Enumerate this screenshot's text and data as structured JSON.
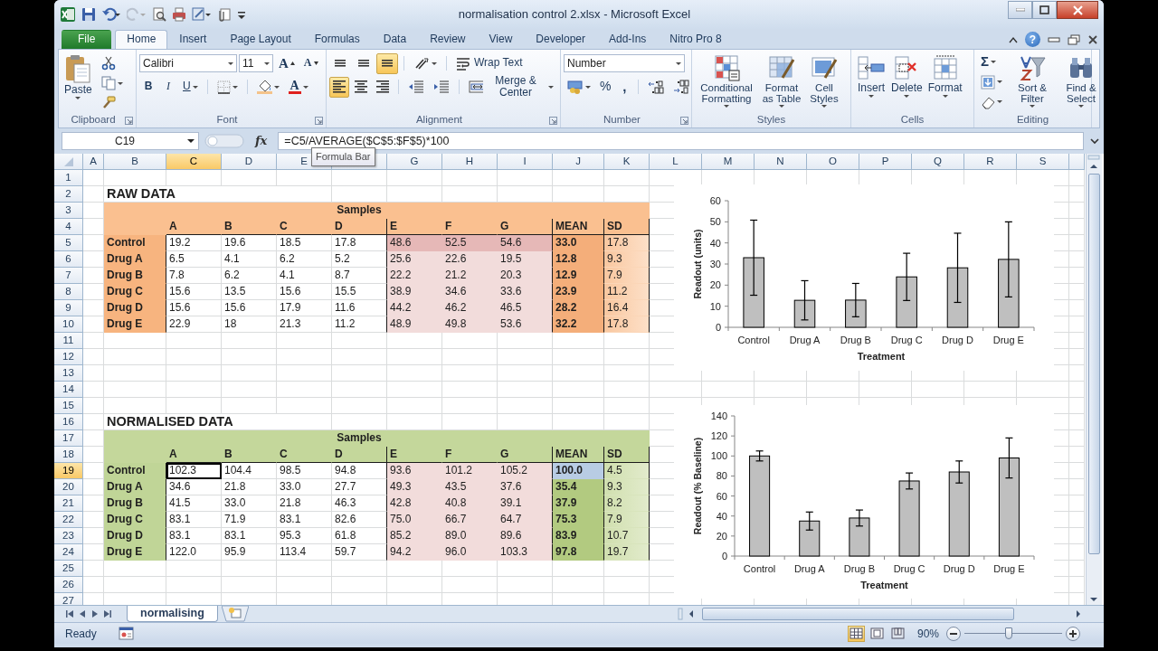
{
  "title_bar": {
    "title": "normalisation control 2.xlsx  -  Microsoft Excel"
  },
  "ribbon_tabs": [
    {
      "label": "File",
      "kind": "file",
      "selected": false
    },
    {
      "label": "Home",
      "kind": "tab",
      "selected": true
    },
    {
      "label": "Insert",
      "kind": "tab",
      "selected": false
    },
    {
      "label": "Page Layout",
      "kind": "tab",
      "selected": false
    },
    {
      "label": "Formulas",
      "kind": "tab",
      "selected": false
    },
    {
      "label": "Data",
      "kind": "tab",
      "selected": false
    },
    {
      "label": "Review",
      "kind": "tab",
      "selected": false
    },
    {
      "label": "View",
      "kind": "tab",
      "selected": false
    },
    {
      "label": "Developer",
      "kind": "tab",
      "selected": false
    },
    {
      "label": "Add-Ins",
      "kind": "tab",
      "selected": false
    },
    {
      "label": "Nitro Pro 8",
      "kind": "tab",
      "selected": false
    }
  ],
  "help": "?",
  "ribbon": {
    "clipboard": {
      "label": "Clipboard",
      "paste": "Paste"
    },
    "font": {
      "label": "Font",
      "font_name": "Calibri",
      "font_size": "11",
      "grow": "A",
      "shrink": "A",
      "bold": "B",
      "italic": "I",
      "underline": "U",
      "font_color": "A"
    },
    "alignment": {
      "label": "Alignment",
      "wrap_text": "Wrap Text",
      "merge": "Merge & Center",
      "vertical": [
        {
          "selected": false
        },
        {
          "selected": false
        },
        {
          "selected": true
        }
      ],
      "horizontal": [
        {
          "selected": true
        },
        {
          "selected": false
        },
        {
          "selected": false
        }
      ]
    },
    "number": {
      "label": "Number",
      "format": "Number",
      "percent": "%",
      "comma": ","
    },
    "styles": {
      "label": "Styles",
      "conditional": "Conditional Formatting",
      "table": "Format as Table",
      "cell_styles": "Cell Styles"
    },
    "cells": {
      "label": "Cells",
      "insert": "Insert",
      "delete": "Delete",
      "format": "Format"
    },
    "editing": {
      "label": "Editing",
      "sum": "Σ",
      "sort": "Sort & Filter",
      "find": "Find & Select"
    }
  },
  "formula_bar": {
    "name_box": "C19",
    "fx": "fx",
    "formula": "=C5/AVERAGE($C$5:$F$5)*100",
    "tooltip": "Formula Bar"
  },
  "columns": [
    {
      "label": "A",
      "selected": false
    },
    {
      "label": "B",
      "selected": false
    },
    {
      "label": "C",
      "selected": true
    },
    {
      "label": "D",
      "selected": false
    },
    {
      "label": "E",
      "selected": false
    },
    {
      "selected": false
    },
    {
      "label": "G",
      "selected": false
    },
    {
      "label": "H",
      "selected": false
    },
    {
      "label": "I",
      "selected": false
    },
    {
      "label": "J",
      "selected": false
    },
    {
      "label": "K",
      "selected": false
    },
    {
      "label": "L",
      "selected": false
    },
    {
      "label": "M",
      "selected": false
    },
    {
      "label": "N",
      "selected": false
    },
    {
      "label": "O",
      "selected": false
    },
    {
      "label": "P",
      "selected": false
    },
    {
      "label": "Q",
      "selected": false
    },
    {
      "label": "R",
      "selected": false
    },
    {
      "label": "S",
      "selected": false
    }
  ],
  "rows": [
    {
      "label": "1",
      "selected": false
    },
    {
      "label": "2",
      "selected": false
    },
    {
      "label": "3",
      "selected": false
    },
    {
      "label": "4",
      "selected": false
    },
    {
      "label": "5",
      "selected": false
    },
    {
      "label": "6",
      "selected": false
    },
    {
      "label": "7",
      "selected": false
    },
    {
      "label": "8",
      "selected": false
    },
    {
      "label": "9",
      "selected": false
    },
    {
      "label": "10",
      "selected": false
    },
    {
      "label": "11",
      "selected": false
    },
    {
      "label": "12",
      "selected": false
    },
    {
      "label": "13",
      "selected": false
    },
    {
      "label": "14",
      "selected": false
    },
    {
      "label": "15",
      "selected": false
    },
    {
      "label": "16",
      "selected": false
    },
    {
      "label": "17",
      "selected": false
    },
    {
      "label": "18",
      "selected": false
    },
    {
      "label": "19",
      "selected": true
    },
    {
      "label": "20",
      "selected": false
    },
    {
      "label": "21",
      "selected": false
    },
    {
      "label": "22",
      "selected": false
    },
    {
      "label": "23",
      "selected": false
    },
    {
      "label": "24",
      "selected": false
    },
    {
      "label": "25",
      "selected": false
    },
    {
      "label": "26",
      "selected": false
    },
    {
      "label": "27",
      "selected": false
    }
  ],
  "raw_data": {
    "title": "RAW DATA",
    "samples": "Samples",
    "headers": [
      "A",
      "B",
      "C",
      "D",
      "E",
      "F",
      "G",
      "MEAN",
      "SD"
    ],
    "rows": [
      {
        "label": "Control",
        "highlighted": true,
        "values": [
          "19.2",
          "19.6",
          "18.5",
          "17.8",
          "48.6",
          "52.5",
          "54.6"
        ],
        "mean": "33.0",
        "sd": "17.8"
      },
      {
        "label": "Drug A",
        "highlighted": false,
        "values": [
          "6.5",
          "4.1",
          "6.2",
          "5.2",
          "25.6",
          "22.6",
          "19.5"
        ],
        "mean": "12.8",
        "sd": "9.3"
      },
      {
        "label": "Drug B",
        "highlighted": false,
        "values": [
          "7.8",
          "6.2",
          "4.1",
          "8.7",
          "22.2",
          "21.2",
          "20.3"
        ],
        "mean": "12.9",
        "sd": "7.9"
      },
      {
        "label": "Drug C",
        "highlighted": false,
        "values": [
          "15.6",
          "13.5",
          "15.6",
          "15.5",
          "38.9",
          "34.6",
          "33.6"
        ],
        "mean": "23.9",
        "sd": "11.2"
      },
      {
        "label": "Drug D",
        "highlighted": false,
        "values": [
          "15.6",
          "15.6",
          "17.9",
          "11.6",
          "44.2",
          "46.2",
          "46.5"
        ],
        "mean": "28.2",
        "sd": "16.4"
      },
      {
        "label": "Drug E",
        "highlighted": false,
        "values": [
          "22.9",
          "18",
          "21.3",
          "11.2",
          "48.9",
          "49.8",
          "53.6"
        ],
        "mean": "32.2",
        "sd": "17.8"
      }
    ]
  },
  "raw_chart": {
    "chart_data": {
      "type": "bar",
      "xlabel": "Treatment",
      "ylabel": "Readout (units)",
      "categories": [
        "Control",
        "Drug A",
        "Drug B",
        "Drug C",
        "Drug D",
        "Drug E"
      ],
      "values": [
        33.0,
        12.8,
        12.9,
        23.9,
        28.2,
        32.2
      ],
      "errors": [
        17.8,
        9.3,
        7.9,
        11.2,
        16.4,
        17.8
      ],
      "ylim": [
        0,
        60
      ],
      "yticks": [
        0,
        10,
        20,
        30,
        40,
        50,
        60
      ]
    }
  },
  "normalised_data": {
    "title": "NORMALISED DATA",
    "samples": "Samples",
    "headers": [
      "A",
      "B",
      "C",
      "D",
      "E",
      "F",
      "G",
      "MEAN",
      "SD"
    ],
    "rows": [
      {
        "label": "Control",
        "mean_highlighted": true,
        "values": [
          {
            "text": "102.3",
            "selected": true
          },
          {
            "text": "104.4",
            "selected": false
          },
          {
            "text": "98.5",
            "selected": false
          },
          {
            "text": "94.8",
            "selected": false
          },
          {
            "text": "93.6",
            "selected": false
          },
          {
            "text": "101.2",
            "selected": false
          },
          {
            "text": "105.2",
            "selected": false
          }
        ],
        "mean": "100.0",
        "sd": "4.5"
      },
      {
        "label": "Drug A",
        "mean_highlighted": false,
        "values": [
          {
            "text": "34.6",
            "selected": false
          },
          {
            "text": "21.8",
            "selected": false
          },
          {
            "text": "33.0",
            "selected": false
          },
          {
            "text": "27.7",
            "selected": false
          },
          {
            "text": "49.3",
            "selected": false
          },
          {
            "text": "43.5",
            "selected": false
          },
          {
            "text": "37.6",
            "selected": false
          }
        ],
        "mean": "35.4",
        "sd": "9.3"
      },
      {
        "label": "Drug B",
        "mean_highlighted": false,
        "values": [
          {
            "text": "41.5",
            "selected": false
          },
          {
            "text": "33.0",
            "selected": false
          },
          {
            "text": "21.8",
            "selected": false
          },
          {
            "text": "46.3",
            "selected": false
          },
          {
            "text": "42.8",
            "selected": false
          },
          {
            "text": "40.8",
            "selected": false
          },
          {
            "text": "39.1",
            "selected": false
          }
        ],
        "mean": "37.9",
        "sd": "8.2"
      },
      {
        "label": "Drug C",
        "mean_highlighted": false,
        "values": [
          {
            "text": "83.1",
            "selected": false
          },
          {
            "text": "71.9",
            "selected": false
          },
          {
            "text": "83.1",
            "selected": false
          },
          {
            "text": "82.6",
            "selected": false
          },
          {
            "text": "75.0",
            "selected": false
          },
          {
            "text": "66.7",
            "selected": false
          },
          {
            "text": "64.7",
            "selected": false
          }
        ],
        "mean": "75.3",
        "sd": "7.9"
      },
      {
        "label": "Drug D",
        "mean_highlighted": false,
        "values": [
          {
            "text": "83.1",
            "selected": false
          },
          {
            "text": "83.1",
            "selected": false
          },
          {
            "text": "95.3",
            "selected": false
          },
          {
            "text": "61.8",
            "selected": false
          },
          {
            "text": "85.2",
            "selected": false
          },
          {
            "text": "89.0",
            "selected": false
          },
          {
            "text": "89.6",
            "selected": false
          }
        ],
        "mean": "83.9",
        "sd": "10.7"
      },
      {
        "label": "Drug E",
        "mean_highlighted": false,
        "values": [
          {
            "text": "122.0",
            "selected": false
          },
          {
            "text": "95.9",
            "selected": false
          },
          {
            "text": "113.4",
            "selected": false
          },
          {
            "text": "59.7",
            "selected": false
          },
          {
            "text": "94.2",
            "selected": false
          },
          {
            "text": "96.0",
            "selected": false
          },
          {
            "text": "103.3",
            "selected": false
          }
        ],
        "mean": "97.8",
        "sd": "19.7"
      }
    ]
  },
  "normalised_chart": {
    "chart_data": {
      "type": "bar",
      "xlabel": "Treatment",
      "ylabel": "Readout (% Baseline)",
      "categories": [
        "Control",
        "Drug A",
        "Drug B",
        "Drug C",
        "Drug D",
        "Drug E"
      ],
      "values": [
        100,
        35,
        38,
        75,
        84,
        98
      ],
      "errors": [
        5,
        9,
        8,
        8,
        11,
        20
      ],
      "ylim": [
        0,
        140
      ],
      "yticks": [
        0,
        20,
        40,
        60,
        80,
        100,
        120,
        140
      ]
    }
  },
  "sheet_tabs": [
    {
      "label": "normalising",
      "selected": true
    }
  ],
  "status_bar": {
    "status": "Ready",
    "zoom": "90%",
    "zoom_slider": {
      "level": 0.45
    },
    "views": [
      {
        "selected": true
      },
      {
        "selected": false
      },
      {
        "selected": false
      }
    ]
  }
}
